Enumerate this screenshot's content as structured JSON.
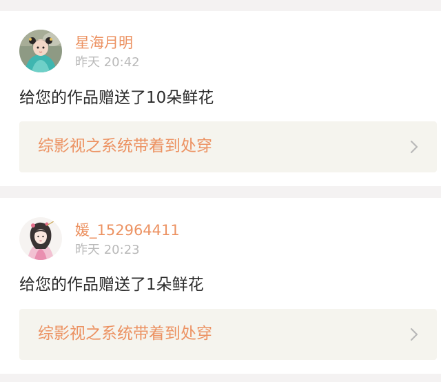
{
  "notifications": [
    {
      "user_name": "星海月明",
      "time": "昨天 20:42",
      "message": "给您的作品赠送了10朵鲜花",
      "work_title": "综影视之系统带着到处穿",
      "avatar_icon": "girl-teal-costume-avatar"
    },
    {
      "user_name": "媛_152964411",
      "time": "昨天 20:23",
      "message": "给您的作品赠送了1朵鲜花",
      "work_title": "综影视之系统带着到处穿",
      "avatar_icon": "ancient-lady-illustration-avatar"
    }
  ],
  "colors": {
    "accent": "#ec9262",
    "muted": "#b9b9b9",
    "text": "#2b2b2b",
    "link_bg": "#f5f4ee",
    "page_bg": "#f4f2f2"
  }
}
